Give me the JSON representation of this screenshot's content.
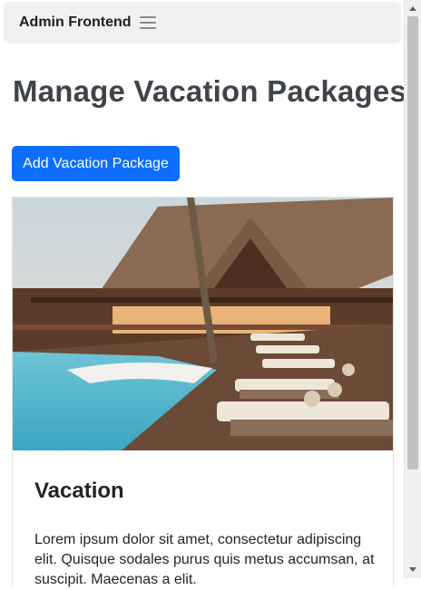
{
  "navbar": {
    "brand": "Admin Frontend",
    "menu_icon": "hamburger-menu-icon"
  },
  "page": {
    "title": "Manage Vacation Packages",
    "add_button_label": "Add Vacation Package"
  },
  "package_card": {
    "image_alt": "resort-pool-photo",
    "title": "Vacation",
    "description": "Lorem ipsum dolor sit amet, consectetur adipiscing elit. Quisque sodales purus quis metus accumsan, at suscipit. Maecenas a elit."
  },
  "colors": {
    "primary": "#0d6efd",
    "navbar_bg": "#f1f1f1",
    "title_text": "#3f444a"
  }
}
